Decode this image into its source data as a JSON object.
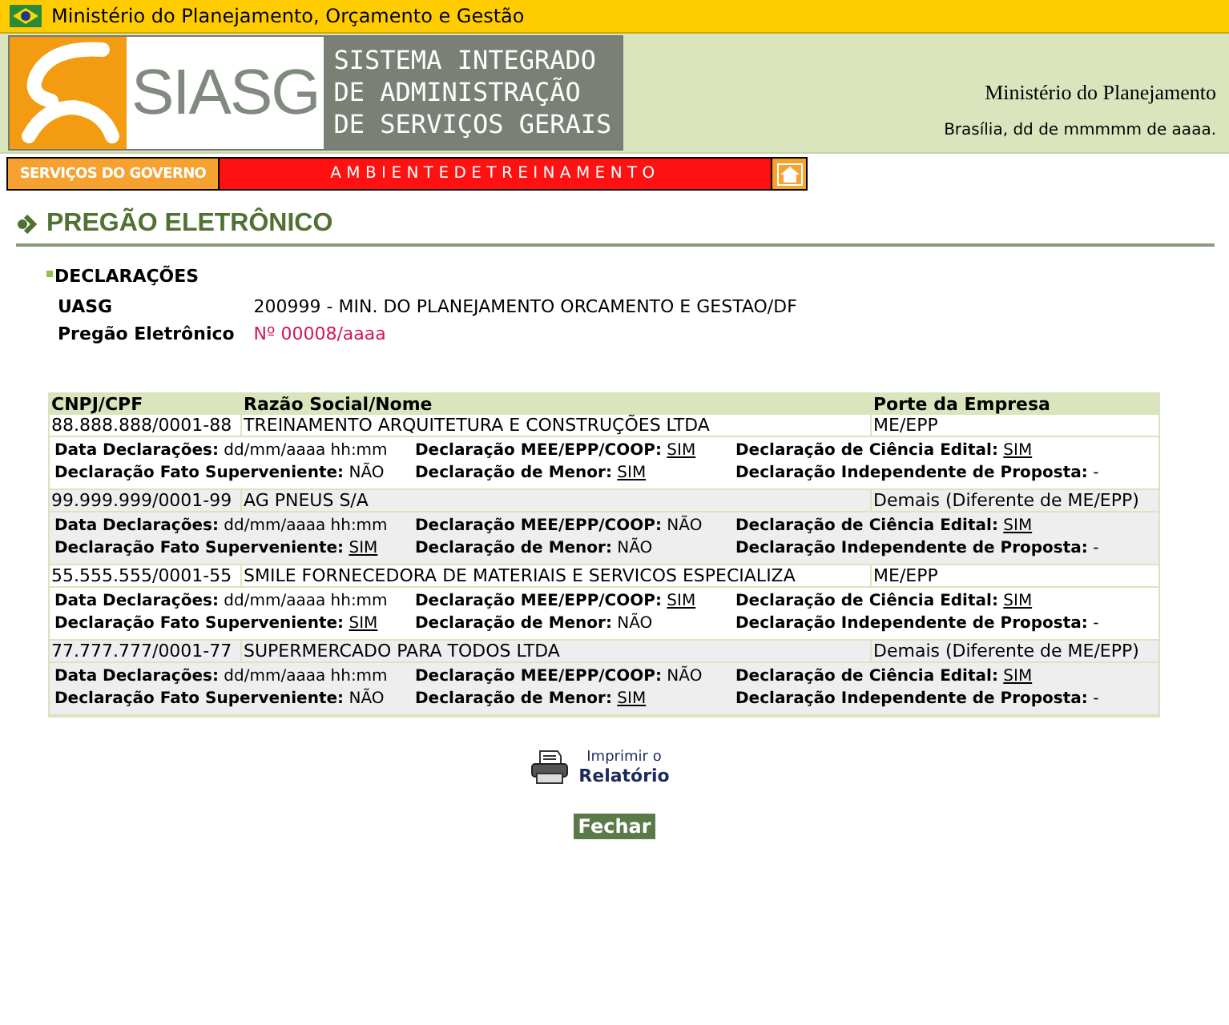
{
  "header": {
    "ministry_bar": "Ministério do Planejamento, Orçamento e Gestão",
    "logo_short": "SIASG",
    "logo_lines": [
      "SISTEMA INTEGRADO",
      "DE ADMINISTRAÇÃO",
      "DE SERVIÇOS GERAIS"
    ],
    "ministry": "Ministério do Planejamento",
    "date_line": "Brasília, dd de mmmmm de aaaa."
  },
  "nav": {
    "services": "SERVIÇOS DO GOVERNO",
    "environment": "AMBIENTEDETREINAMENTO"
  },
  "page_title": "PREGÃO ELETRÔNICO",
  "section": "DECLARAÇÕES",
  "info": [
    {
      "label": "UASG",
      "value": "200999 - MIN. DO PLANEJAMENTO ORCAMENTO E GESTAO/DF",
      "kind": "plain"
    },
    {
      "label": "Pregão Eletrônico",
      "value": "Nº 00008/aaaa",
      "kind": "highlight"
    }
  ],
  "table": {
    "columns": [
      "CNPJ/CPF",
      "Razão Social/Nome",
      "Porte da Empresa"
    ],
    "rows": [
      {
        "cells": [
          "88.888.888/0001-88",
          "TREINAMENTO ARQUITETURA E CONSTRUÇÕES LTDA",
          "ME/EPP"
        ],
        "declarations": [
          {
            "label": "Data Declarações:",
            "value": "dd/mm/aaaa hh:mm",
            "linked": false
          },
          {
            "label": "Declaração MEE/EPP/COOP:",
            "value": "SIM",
            "linked": true
          },
          {
            "label": "Declaração de Ciência Edital:",
            "value": "SIM",
            "linked": true
          },
          {
            "label": "Declaração Fato Superveniente:",
            "value": "NÃO",
            "linked": false
          },
          {
            "label": "Declaração de Menor:",
            "value": "SIM",
            "linked": true
          },
          {
            "label": "Declaração Independente de Proposta:",
            "value": "-",
            "linked": false
          }
        ]
      },
      {
        "cells": [
          "99.999.999/0001-99",
          "AG PNEUS S/A",
          "Demais (Diferente de ME/EPP)"
        ],
        "declarations": [
          {
            "label": "Data Declarações:",
            "value": "dd/mm/aaaa hh:mm",
            "linked": false
          },
          {
            "label": "Declaração MEE/EPP/COOP:",
            "value": "NÃO",
            "linked": false
          },
          {
            "label": "Declaração de Ciência Edital:",
            "value": "SIM",
            "linked": true
          },
          {
            "label": "Declaração Fato Superveniente:",
            "value": "SIM",
            "linked": true
          },
          {
            "label": "Declaração de Menor:",
            "value": "NÃO",
            "linked": false
          },
          {
            "label": "Declaração Independente de Proposta:",
            "value": "-",
            "linked": false
          }
        ]
      },
      {
        "cells": [
          "55.555.555/0001-55",
          "SMILE FORNECEDORA DE MATERIAIS E SERVICOS ESPECIALIZA",
          "ME/EPP"
        ],
        "declarations": [
          {
            "label": "Data Declarações:",
            "value": "dd/mm/aaaa hh:mm",
            "linked": false
          },
          {
            "label": "Declaração MEE/EPP/COOP:",
            "value": "SIM",
            "linked": true
          },
          {
            "label": "Declaração de Ciência Edital:",
            "value": "SIM",
            "linked": true
          },
          {
            "label": "Declaração Fato Superveniente:",
            "value": "SIM",
            "linked": true
          },
          {
            "label": "Declaração de Menor:",
            "value": "NÃO",
            "linked": false
          },
          {
            "label": "Declaração Independente de Proposta:",
            "value": "-",
            "linked": false
          }
        ]
      },
      {
        "cells": [
          "77.777.777/0001-77",
          "SUPERMERCADO PARA TODOS LTDA",
          "Demais (Diferente de ME/EPP)"
        ],
        "declarations": [
          {
            "label": "Data Declarações:",
            "value": "dd/mm/aaaa hh:mm",
            "linked": false
          },
          {
            "label": "Declaração MEE/EPP/COOP:",
            "value": "NÃO",
            "linked": false
          },
          {
            "label": "Declaração de Ciência Edital:",
            "value": "SIM",
            "linked": true
          },
          {
            "label": "Declaração Fato Superveniente:",
            "value": "NÃO",
            "linked": false
          },
          {
            "label": "Declaração de Menor:",
            "value": "SIM",
            "linked": true
          },
          {
            "label": "Declaração Independente de Proposta:",
            "value": "-",
            "linked": false
          }
        ]
      }
    ]
  },
  "print_link": {
    "line1": "Imprimir o",
    "line2": "Relatório"
  },
  "close_button": "Fechar"
}
